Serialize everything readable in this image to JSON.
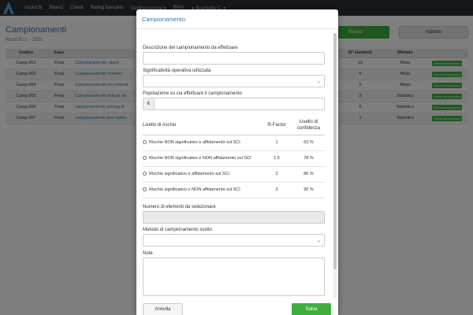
{
  "navbar": {
    "items": [
      "Incarichi",
      "Bilanci",
      "Clienti",
      "Rating bancario",
      "Configurazione ▾",
      "Bilinx"
    ],
    "user": "Brandella C. ▾"
  },
  "page": {
    "title": "Campionamenti",
    "subtitle": "Rossi S.r.l. - 2021",
    "new_button": "Nuovo",
    "back_button": "Indietro"
  },
  "table": {
    "headers": [
      "Codice",
      "Fase",
      ""
    ],
    "right_headers": [
      "N° elementi",
      "Metodo",
      ""
    ],
    "rows": [
      {
        "code": "Camp.001",
        "phase": "Final",
        "desc": "Campionamento clienti",
        "n": "10",
        "method": "Misto",
        "action": "Seleziona campioni"
      },
      {
        "code": "Camp.002",
        "phase": "Final",
        "desc": "Campionamento fornitori",
        "n": "5",
        "method": "Misto",
        "action": "Seleziona campioni"
      },
      {
        "code": "Camp.004",
        "phase": "Final",
        "desc": "Campionamento incrementi",
        "n": "5",
        "method": "Misto",
        "action": "Seleziona campioni"
      },
      {
        "code": "Camp.005",
        "phase": "Final",
        "desc": "Campionamento fatture da",
        "n": "2",
        "method": "Statistico",
        "action": "Seleziona campioni"
      },
      {
        "code": "Camp.006",
        "phase": "Final",
        "desc": "campionamento pricing di",
        "n": "6",
        "method": "Statistico",
        "action": "Seleziona campioni"
      },
      {
        "code": "Camp.007",
        "phase": "Final",
        "desc": "campionamento test valore",
        "n": "1",
        "method": "Statistico",
        "action": "Seleziona campioni"
      }
    ]
  },
  "modal": {
    "title": "Campionamento",
    "description_label": "Descrizione del campionamento da effettuare",
    "description_value": "",
    "significance_label": "Significatività operativa utilizzata",
    "significance_value": "",
    "population_label": "Popolazione su cui effettuare il campionamento",
    "population_prefix": "€",
    "population_value": "",
    "risk_table": {
      "col_level": "Livello di rischio",
      "col_factor": "R-Factor",
      "col_confidence": "Livello di confidenza",
      "rows": [
        {
          "label": "Rischio NON significativo e affidamento sul SCI",
          "factor": "1",
          "confidence": "63 %"
        },
        {
          "label": "Rischio NON significativo e NON affidamento sul SCI",
          "factor": "1,5",
          "confidence": "78 %"
        },
        {
          "label": "Rischio significativo e affidamento sul SCI",
          "factor": "2",
          "confidence": "86 %"
        },
        {
          "label": "Rischio significativo e NON affidamento sul SCI",
          "factor": "3",
          "confidence": "95 %"
        }
      ]
    },
    "elements_label": "Numero di elementi da selezionare",
    "elements_value": "",
    "method_label": "Metodo di campionamento scelto",
    "method_value": "",
    "notes_label": "Note",
    "notes_value": "",
    "cancel_button": "Annulla",
    "save_button": "Salva"
  },
  "colors": {
    "accent": "#2a7ab0",
    "success": "#3fae3f",
    "navbar": "#2a2f35"
  }
}
